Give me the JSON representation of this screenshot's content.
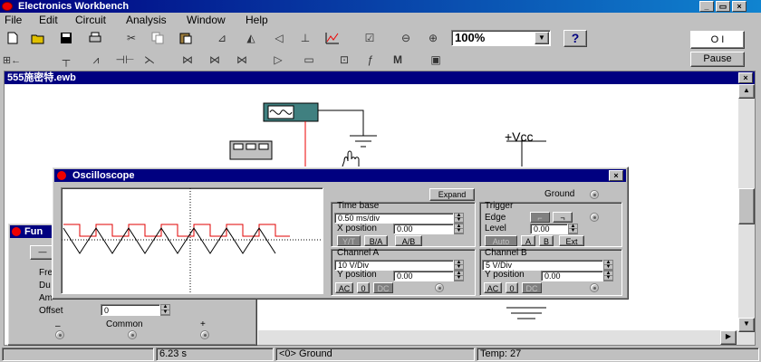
{
  "app": {
    "title": "Electronics Workbench",
    "document_title": "555施密特.ewb"
  },
  "menu": [
    "File",
    "Edit",
    "Circuit",
    "Analysis",
    "Window",
    "Help"
  ],
  "toolbar": {
    "zoom_value": "100%",
    "help_label": "?",
    "power_label": "O I",
    "pause_label": "Pause"
  },
  "toolbar_icons": [
    "new-icon",
    "open-icon",
    "save-icon",
    "print-icon",
    "cut-icon",
    "copy-icon",
    "paste-icon",
    "rotate-icon",
    "flip-horizontal-icon",
    "flip-vertical-icon",
    "subcircuit-icon",
    "graph-icon",
    "component-properties-icon",
    "zoom-out-icon",
    "zoom-in-icon"
  ],
  "parts_icons": [
    "sources-bin-icon",
    "basic-bin-icon",
    "diodes-bin-icon",
    "transistors-bin-icon",
    "analog-ics-bin-icon",
    "mixed-ics-bin-icon",
    "digital-ics-bin-icon",
    "logic-gates-bin-icon",
    "digital-bin-icon",
    "indicators-bin-icon",
    "controls-bin-icon",
    "miscellaneous-bin-icon",
    "instruments-bin-icon"
  ],
  "canvas": {
    "vcc_label": "+Vcc"
  },
  "oscilloscope": {
    "title": "Oscilloscope",
    "expand_label": "Expand",
    "ground_label": "Ground",
    "timebase": {
      "title": "Time base",
      "value": "0.50 ms/div",
      "xpos_label": "X position",
      "xpos_value": "0.00",
      "modes": [
        "Y/T",
        "B/A",
        "A/B"
      ]
    },
    "trigger": {
      "title": "Trigger",
      "edge_label": "Edge",
      "level_label": "Level",
      "level_value": "0.00",
      "sources": [
        "Auto",
        "A",
        "B",
        "Ext"
      ]
    },
    "channel_a": {
      "title": "Channel A",
      "scale": "10 V/Div",
      "ypos_label": "Y position",
      "ypos_value": "0.00",
      "coupling": [
        "AC",
        "0",
        "DC"
      ]
    },
    "channel_b": {
      "title": "Channel  B",
      "scale": "5 V/Div",
      "ypos_label": "Y position",
      "ypos_value": "0.00",
      "coupling": [
        "AC",
        "0",
        "DC"
      ]
    },
    "trace_colors": {
      "a": "#000000",
      "b": "#e00000"
    }
  },
  "function_generator": {
    "title": "Fun",
    "fields": [
      "Fre",
      "Du",
      "Am"
    ],
    "offset_label": "Offset",
    "offset_value": "0",
    "terminal_minus": "–",
    "terminal_common": "Common",
    "terminal_plus": "+"
  },
  "statusbar": {
    "blank": "",
    "time": "6.23 s",
    "message": "<0> Ground",
    "temp": "Temp:  27"
  }
}
